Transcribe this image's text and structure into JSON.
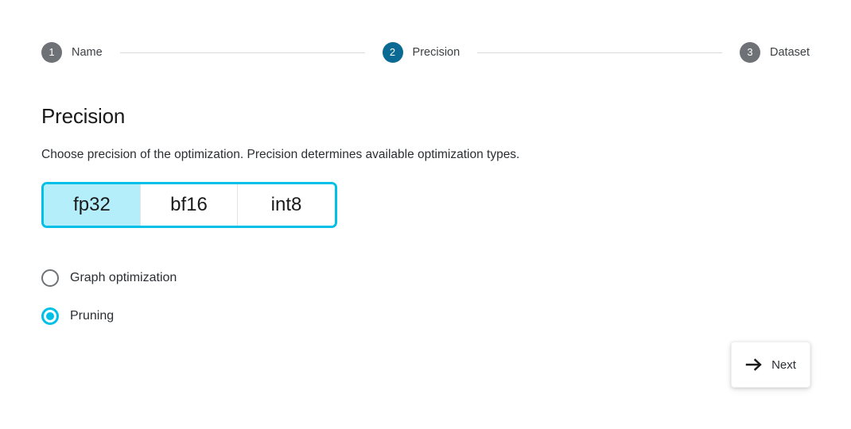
{
  "stepper": {
    "steps": [
      {
        "number": "1",
        "label": "Name",
        "state": "inactive"
      },
      {
        "number": "2",
        "label": "Precision",
        "state": "active"
      },
      {
        "number": "3",
        "label": "Dataset",
        "state": "inactive"
      }
    ]
  },
  "main": {
    "title": "Precision",
    "description": "Choose precision of the optimization. Precision determines available optimization types.",
    "precision_options": [
      {
        "label": "fp32",
        "selected": true
      },
      {
        "label": "bf16",
        "selected": false
      },
      {
        "label": "int8",
        "selected": false
      }
    ],
    "optimization_types": [
      {
        "label": "Graph optimization",
        "checked": false
      },
      {
        "label": "Pruning",
        "checked": true
      }
    ]
  },
  "footer": {
    "next_label": "Next",
    "next_icon": "arrow-right-icon"
  },
  "colors": {
    "accent_cyan": "#00c0e8",
    "accent_cyan_light": "#b5eefb",
    "step_active": "#0b6a93",
    "step_inactive": "#6e7276"
  }
}
